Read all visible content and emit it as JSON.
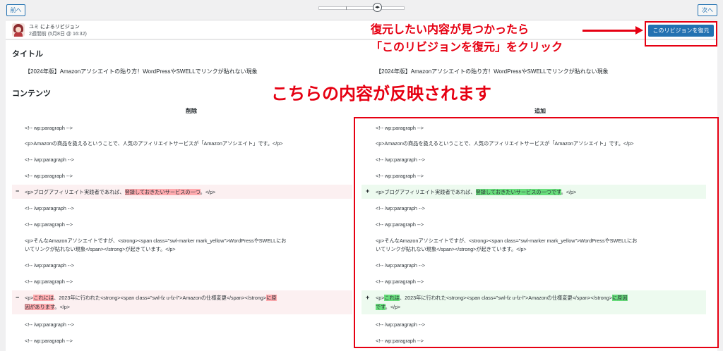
{
  "nav": {
    "prev": "前へ",
    "next": "次へ",
    "slider_handle": "◂▸"
  },
  "revision": {
    "author": "ユミ によるリビジョン",
    "time": "2週間前 (5月8日 @ 16:32)",
    "restore_button": "このリビジョンを復元"
  },
  "annotations": {
    "line1": "復元したい内容が見つかったら",
    "line2": "「このリビジョンを復元」をクリック",
    "big": "こちらの内容が反映されます"
  },
  "sections": {
    "title": "タイトル",
    "content": "コンテンツ"
  },
  "post_title": {
    "left": "【2024年版】Amazonアソシエイトの貼り方！WordPressやSWELLでリンクが貼れない現象",
    "right": "【2024年版】Amazonアソシエイトの貼り方！WordPressやSWELLでリンクが貼れない現象"
  },
  "columns": {
    "removed": "削除",
    "added": "追加"
  },
  "diff": {
    "l1": "<!-- wp:paragraph -->",
    "l2": "<p>Amazonの商品を扱えるということで、人気のアフィリエイトサービスが「Amazonアソシエイト」です。</p>",
    "l3": "<!-- /wp:paragraph -->",
    "l4": "<!-- wp:paragraph -->",
    "del5_pre": "<p>ブログアフィリエイト実践者であれば、",
    "del5_mark": "登録しておきたいサービスの一つ",
    "del5_post": "。</p>",
    "add5_pre": "<p>ブログアフィリエイト実践者であれば、",
    "add5_mark": "登録しておきたいサービスの一つです",
    "add5_post": "。</p>",
    "l6": "<!-- /wp:paragraph -->",
    "l7": "<!-- wp:paragraph -->",
    "l8a_left": "<p>そんなAmazonアソシエイトですが、<strong><span class=\"swl-marker mark_yellow\">WordPressやSWELLにお",
    "l8b_left": "いてリンクが貼れない現象</span></strong>が起きています。</p>",
    "l8a_right": "<p>そんなAmazonアソシエイトですが、<strong><span class=\"swl-marker mark_yellow\">WordPressやSWELLにお",
    "l8b_right": "いてリンクが貼れない現象</span></strong>が起きています。</p>",
    "l9": "<!-- /wp:paragraph -->",
    "l10": "<!-- wp:paragraph -->",
    "del11_pre": "<p>",
    "del11_mark": "これには",
    "del11_mid": "、2023年に行われた<strong><span class=\"swl-fz u-fz-l\">Amazonの仕様変更</span></strong>",
    "del11_mark2": "に原",
    "del11b_mark": "因があります",
    "del11b_post": "。</p>",
    "add11_pre": "<p>",
    "add11_mark": "これは",
    "add11_mid": "、2023年に行われた<strong><span class=\"swl-fz u-fz-l\">Amazonの仕様変更</span></strong>",
    "add11_mark2": "に原因",
    "add11b_mark": "です",
    "add11b_post": "。</p>",
    "l12": "<!-- /wp:paragraph -->",
    "l13": "<!-- wp:paragraph -->",
    "minus": "−",
    "plus": "+"
  },
  "colors": {
    "accent": "#2271b1",
    "annotation": "#e60012",
    "del_bg": "#fcf0f1",
    "add_bg": "#edfaef",
    "del_mark": "#ffabaf",
    "add_mark": "#68de7c"
  }
}
